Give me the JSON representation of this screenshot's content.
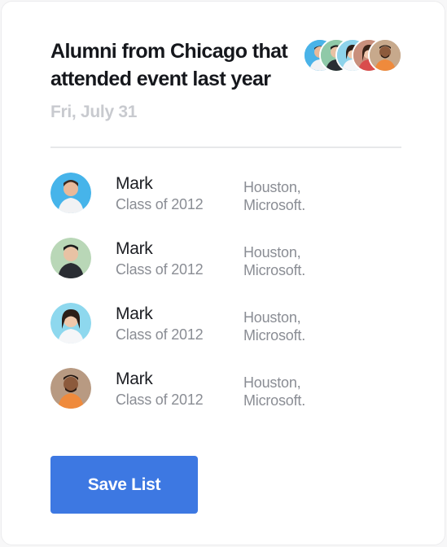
{
  "card": {
    "title": "Alumni from Chicago that attended event last year",
    "date": "Fri, July 31"
  },
  "header_avatars": [
    {
      "icon": "person-avatar-icon",
      "bg": "#4ab3e8"
    },
    {
      "icon": "person-avatar-icon",
      "bg": "#8fc9a8"
    },
    {
      "icon": "person-avatar-icon",
      "bg": "#8ed3ea"
    },
    {
      "icon": "person-avatar-icon",
      "bg": "#c98f7c"
    },
    {
      "icon": "person-avatar-icon",
      "bg": "#c7a98c"
    }
  ],
  "alumni": [
    {
      "name": "Mark",
      "class": "Class of 2012",
      "city": "Houston,",
      "company": "Microsoft.",
      "avatar_bg": "#46b4ea"
    },
    {
      "name": "Mark",
      "class": "Class of 2012",
      "city": "Houston,",
      "company": "Microsoft.",
      "avatar_bg": "#b9d7b7"
    },
    {
      "name": "Mark",
      "class": "Class of 2012",
      "city": "Houston,",
      "company": "Microsoft.",
      "avatar_bg": "#8ed8ee"
    },
    {
      "name": "Mark",
      "class": "Class of 2012",
      "city": "Houston,",
      "company": "Microsoft.",
      "avatar_bg": "#b89a82"
    }
  ],
  "actions": {
    "save_label": "Save List"
  },
  "colors": {
    "accent": "#3d78e2",
    "title": "#15171c",
    "muted": "#8a8d94",
    "date": "#c8cacf"
  }
}
